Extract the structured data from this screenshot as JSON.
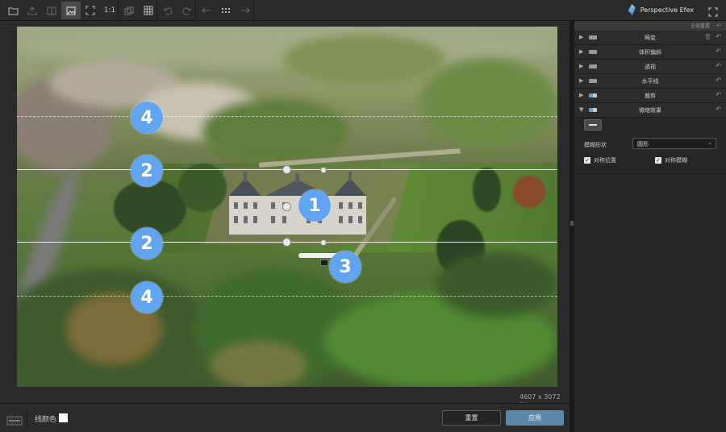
{
  "app": {
    "name": "Perspective Efex"
  },
  "toolbar": {
    "zoom_label": "1:1"
  },
  "image": {
    "resolution": "4607 x 3072 px"
  },
  "overlay": {
    "markers": [
      "4",
      "2",
      "1",
      "2",
      "3",
      "4"
    ]
  },
  "bottom": {
    "line_color_label": "线颜色",
    "line_color": "#fafafa",
    "reset_label": "重置",
    "apply_label": "应用"
  },
  "panel": {
    "reset_all": "全部重置",
    "sections": [
      {
        "label": "畸变",
        "toggle": "off",
        "expanded": false
      },
      {
        "label": "体积偏斜",
        "toggle": "off",
        "expanded": false
      },
      {
        "label": "透视",
        "toggle": "off",
        "expanded": false
      },
      {
        "label": "水平线",
        "toggle": "off",
        "expanded": false
      },
      {
        "label": "裁剪",
        "toggle": "on",
        "expanded": false
      },
      {
        "label": "微缩效果",
        "toggle": "on",
        "expanded": true
      }
    ],
    "miniature": {
      "shape_label": "模糊形状",
      "shape_value": "圆形",
      "symmetric_position_label": "对称位置",
      "symmetric_position_checked": true,
      "symmetric_blur_label": "对称模糊",
      "symmetric_blur_checked": true
    }
  },
  "colors": {
    "accent": "#61a5f0",
    "apply_button": "#5a88a8",
    "background": "#232323"
  }
}
